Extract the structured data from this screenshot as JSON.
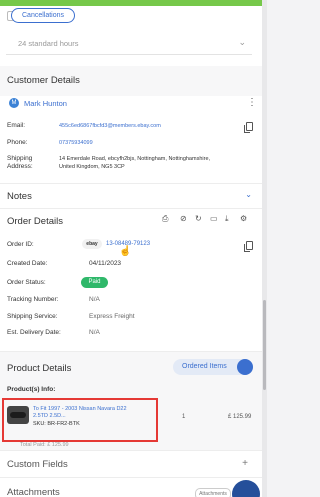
{
  "top": {
    "cancel_label": "Cancellations",
    "delivery_option": "24 standard hours"
  },
  "customer": {
    "section_title": "Customer Details",
    "avatar_initial": "M",
    "name": "Mark Hunton",
    "email_label": "Email:",
    "email": "455c6ed6867fbcfd3@members.ebay.com",
    "phone_label": "Phone:",
    "phone": "07375934099",
    "shipping_label_1": "Shipping",
    "shipping_label_2": "Address:",
    "address_line1": "14 Emerdale Road, ebcyfh2bjs, Nottingham, Nottinghamshire,",
    "address_line2": "United Kingdom, NG5 3CP"
  },
  "notes": {
    "section_title": "Notes"
  },
  "order": {
    "section_title": "Order Details",
    "order_id_label": "Order ID:",
    "order_badge": "ebay",
    "order_id": "13-08489-79123",
    "created_label": "Created Date:",
    "created_date": "04/11/2023",
    "status_label": "Order Status:",
    "status": "Paid",
    "tracking_label": "Tracking Number:",
    "tracking": "N/A",
    "shipping_service_label": "Shipping Service:",
    "shipping_service": "Express Freight",
    "delivery_label": "Est. Delivery Date:",
    "delivery": "N/A"
  },
  "product": {
    "section_title": "Product Details",
    "toggle_label": "Ordered Items",
    "info_label": "Product(s) Info:",
    "line1": "To Fit 1997 - 2003 Nissan Navara D22",
    "line2": "2.5TD 2.5D...",
    "line3": "SKU: BR-FR2-BTK",
    "qty": "1",
    "price": "£ 125.99",
    "footer_text": "Total Paid: £ 125.99"
  },
  "custom_fields": {
    "section_title": "Custom Fields"
  },
  "attachments": {
    "section_title": "Attachments",
    "button_label": "Attachments"
  },
  "colors": {
    "accent": "#3b6fcf",
    "paid": "#2fb86a",
    "highlight": "#e53935"
  }
}
